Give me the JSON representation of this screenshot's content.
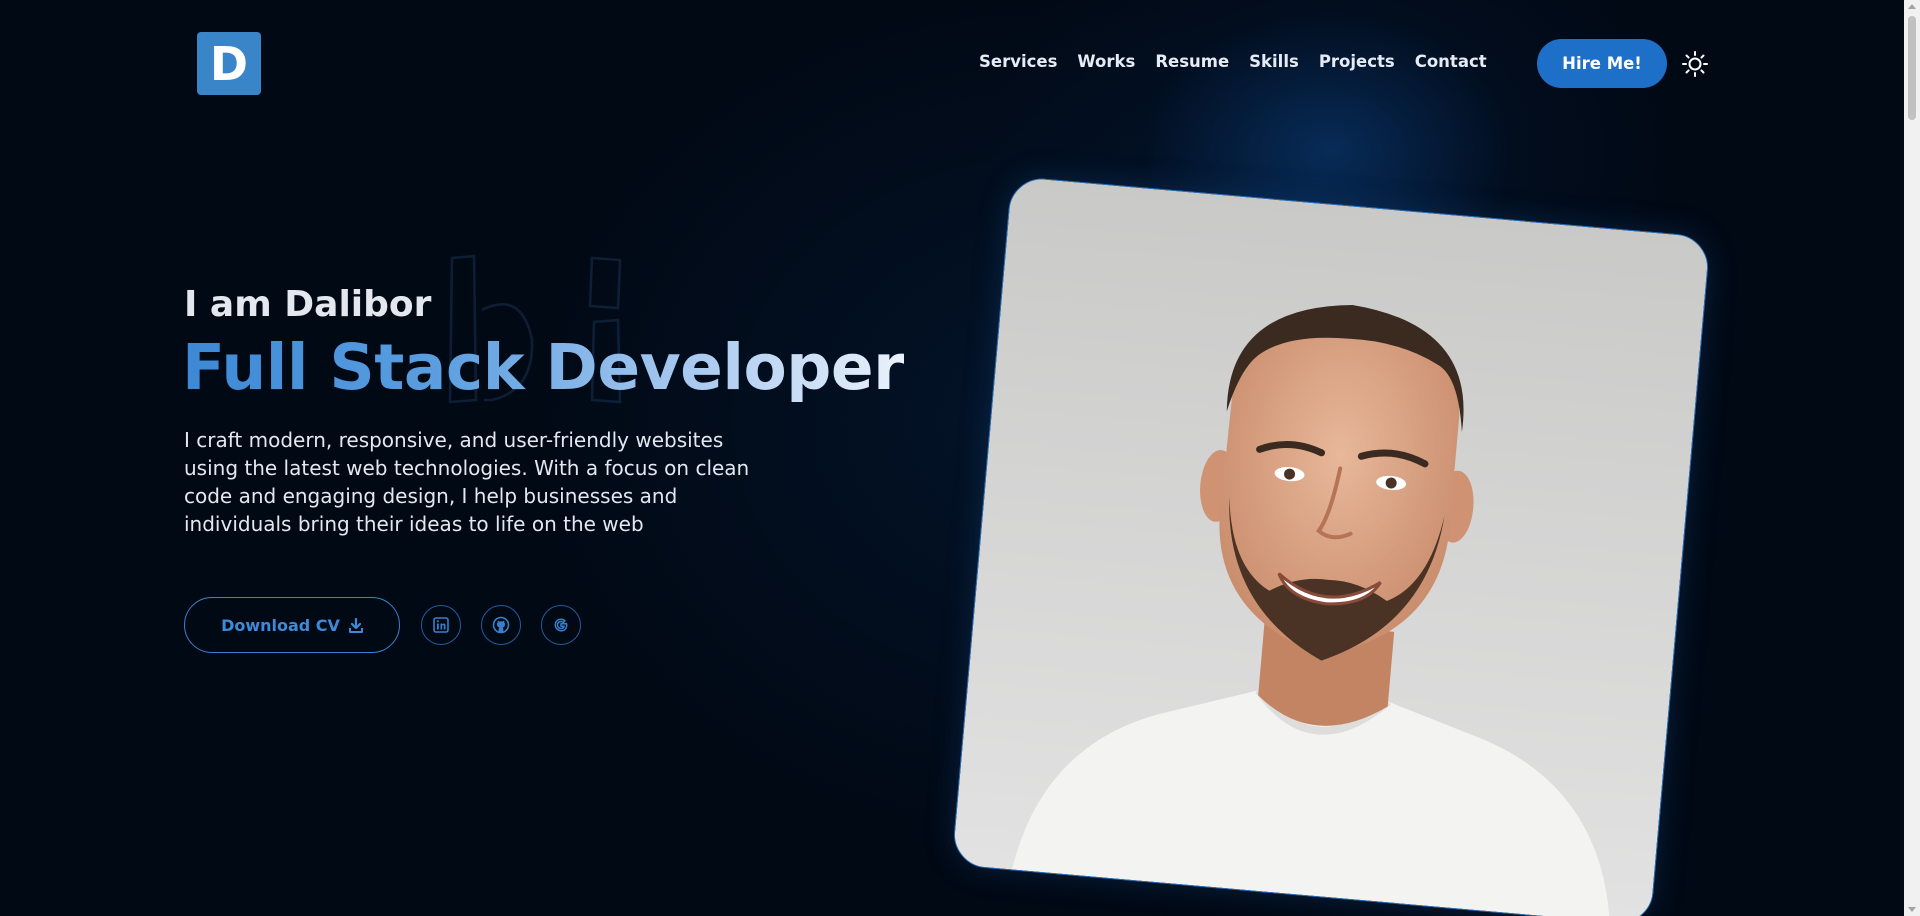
{
  "header": {
    "logo_letter": "D",
    "nav_items": [
      {
        "label": "Services"
      },
      {
        "label": "Works"
      },
      {
        "label": "Resume"
      },
      {
        "label": "Skills"
      },
      {
        "label": "Projects"
      },
      {
        "label": "Contact"
      }
    ],
    "hire_label": "Hire Me!",
    "theme_toggle_icon": "sun-icon"
  },
  "hero": {
    "greeting": "I am Dalibor",
    "title": "Full Stack Developer",
    "description": "I craft modern, responsive, and user-friendly websites using the latest web technologies. With a focus on clean code and engaging design, I help businesses and individuals bring their ideas to life on the web",
    "download_label": "Download CV",
    "download_icon": "download-icon",
    "socials": [
      {
        "icon": "linkedin-icon"
      },
      {
        "icon": "github-icon"
      },
      {
        "icon": "google-icon"
      }
    ]
  },
  "colors": {
    "background": "#010915",
    "accent": "#1e6fc8",
    "logo": "#3a85c8",
    "title_gradient_start": "#3c88d6",
    "title_gradient_end": "#eaf2fc"
  }
}
